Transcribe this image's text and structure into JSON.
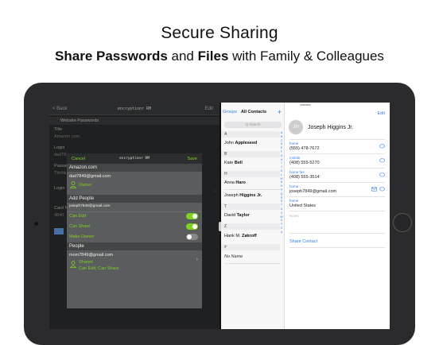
{
  "hero": {
    "title": "Secure Sharing",
    "subtitle_bold1": "Share Passwords",
    "subtitle_mid": " and ",
    "subtitle_bold2": "Files",
    "subtitle_end": " with Family & Colleagues"
  },
  "left_app": {
    "nav": {
      "back": "< Back",
      "title": "encryptionr RM",
      "edit": "Edit"
    },
    "section_title": "Website Passwords",
    "rows": [
      {
        "label": "Title",
        "value": "Amazon.com"
      },
      {
        "label": "Login",
        "value": "dad78"
      },
      {
        "label": "Passw",
        "value": "Tbnhk"
      },
      {
        "label": "Login",
        "value": ""
      },
      {
        "label": "Card N",
        "value": "4840"
      }
    ]
  },
  "modal": {
    "cancel": "Cancel",
    "title": "encryptionr RM",
    "save": "Save",
    "item_title": "Amazon.com",
    "owner_email": "dad7849@gmail.com",
    "owner_role": "Owner",
    "add_people_header": "Add People",
    "invite_email": "joseph7849@gmail.com",
    "toggles": [
      {
        "label": "Can Edit",
        "state": "on"
      },
      {
        "label": "Can Share",
        "state": "on"
      },
      {
        "label": "Make Owner",
        "state": "off"
      }
    ],
    "people_header": "People",
    "person_email": "mom7849@gmail.com",
    "person_status": "Shared",
    "person_perms": "Can Edit, Can Share",
    "accent_color": "#7dd321"
  },
  "contacts": {
    "groups": "Groups",
    "all_contacts": "All Contacts",
    "add": "+",
    "search_placeholder": "Q  Search",
    "entries": [
      {
        "letter": "A",
        "first": "John",
        "last": "Appleseed"
      },
      {
        "letter": "B",
        "first": "Kate",
        "last": "Bell"
      },
      {
        "letter": "H",
        "first": "Anna",
        "last": "Haro"
      },
      {
        "letter": "",
        "first": "Joseph",
        "last": "Higgins Jr."
      },
      {
        "letter": "T",
        "first": "David",
        "last": "Taylor"
      },
      {
        "letter": "Z",
        "first": "Hank M.",
        "last": "Zakroff"
      },
      {
        "letter": "#",
        "first": "No Name",
        "last": ""
      }
    ],
    "index": [
      "A",
      "B",
      "C",
      "D",
      "E",
      "F",
      "G",
      "H",
      "I",
      "J",
      "K",
      "L",
      "M",
      "N",
      "O",
      "P",
      "Q",
      "R",
      "S",
      "T",
      "U",
      "V",
      "W",
      "X",
      "Y",
      "Z",
      "#"
    ]
  },
  "detail": {
    "edit": "Edit",
    "initials": "JH",
    "name": "Joseph Higgins Jr.",
    "fields": [
      {
        "label": "home",
        "value": "(555) 478-7672"
      },
      {
        "label": "mobile",
        "value": "(408) 555-5270"
      },
      {
        "label": "home fax",
        "value": "(408) 555-3514"
      },
      {
        "label": "home",
        "value": "joseph7849@gmail.com"
      },
      {
        "label": "home",
        "value": "United States"
      }
    ],
    "notes_label": "Notes",
    "share_contact": "Share Contact",
    "link_color": "#2f7de1"
  }
}
